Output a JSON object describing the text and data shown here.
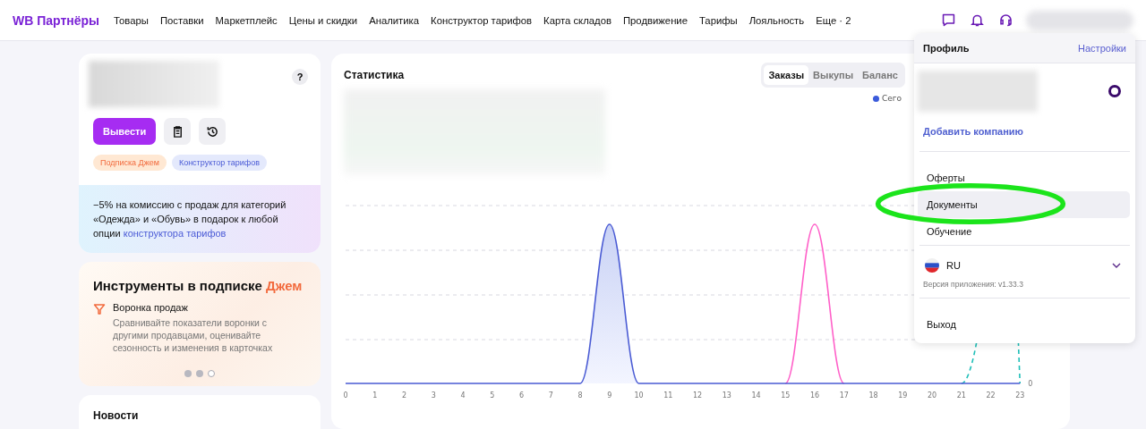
{
  "nav": {
    "logo": "WB Партнёры",
    "items": [
      "Товары",
      "Поставки",
      "Маркетплейс",
      "Цены и скидки",
      "Аналитика",
      "Конструктор тарифов",
      "Карта складов",
      "Продвижение",
      "Тарифы",
      "Лояльность",
      "Еще · 2"
    ]
  },
  "balance_card": {
    "help": "?",
    "withdraw": "Вывести",
    "tags": [
      {
        "label": "Подписка Джем",
        "kind": "orange"
      },
      {
        "label": "Конструктор тарифов",
        "kind": "blue"
      }
    ],
    "promo_text": "−5% на комиссию с продаж для категорий «Одежда» и «Обувь» в подарок к любой опции ",
    "promo_link": "конструктора тарифов"
  },
  "tools_card": {
    "title": "Инструменты в подписке ",
    "title_accent": "Джем",
    "feature_title": "Воронка продаж",
    "feature_text": "Сравнивайте показатели воронки с другими продавцами, оценивайте сезонность и изменения в карточках",
    "dots": [
      {
        "selected": false
      },
      {
        "selected": false
      },
      {
        "selected": true
      }
    ]
  },
  "news_card": {
    "title": "Новости"
  },
  "stats": {
    "title": "Статистика",
    "tabs": [
      {
        "label": "Заказы",
        "selected": true
      },
      {
        "label": "Выкупы",
        "selected": false
      },
      {
        "label": "Баланс",
        "selected": false
      }
    ],
    "legend": [
      {
        "label": "Сего",
        "color": "#3b5bdb"
      }
    ],
    "y_label": "0",
    "x_labels": [
      "0",
      "1",
      "2",
      "3",
      "4",
      "5",
      "6",
      "7",
      "8",
      "9",
      "10",
      "11",
      "12",
      "13",
      "14",
      "15",
      "16",
      "17",
      "18",
      "19",
      "20",
      "21",
      "22",
      "23"
    ]
  },
  "profile_menu": {
    "title": "Профиль",
    "settings": "Настройки",
    "company_selected": true,
    "add_company": "Добавить компанию",
    "items": [
      {
        "label": "Оферты",
        "selected": false
      },
      {
        "label": "Документы",
        "selected": true
      },
      {
        "label": "Обучение",
        "selected": false
      }
    ],
    "language": "RU",
    "version": "Версия приложения: v1.33.3",
    "logout": "Выход"
  },
  "annotation": {
    "kind": "ellipse"
  }
}
